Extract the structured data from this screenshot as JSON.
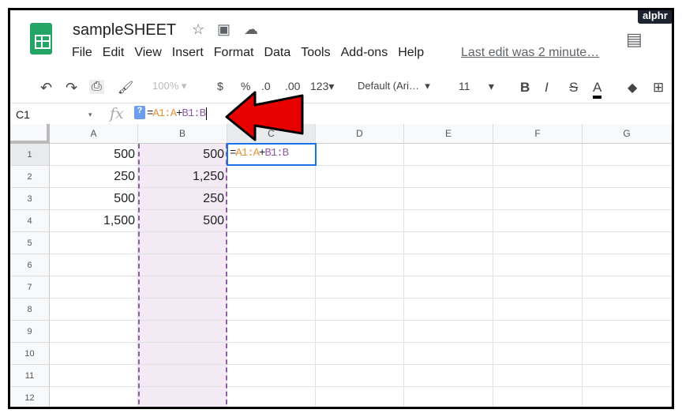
{
  "app": {
    "title": "sampleSHEET",
    "last_edit": "Last edit was 2 minute…",
    "watermark": "alphr"
  },
  "menu": [
    "File",
    "Edit",
    "View",
    "Insert",
    "Format",
    "Data",
    "Tools",
    "Add-ons",
    "Help"
  ],
  "toolbar": {
    "zoom": "100%",
    "currency": "$",
    "percent": "%",
    "dec_less": ".0",
    "dec_more": ".00",
    "format": "123",
    "font": "Default (Ari…",
    "size": "11",
    "bold": "B",
    "italic": "I",
    "strike": "S",
    "textcolor": "A"
  },
  "formula_bar": {
    "name_box": "C1",
    "fx": "fx",
    "help": "?",
    "formula_parts": [
      "=",
      "A1:A",
      "+",
      "B1:B"
    ]
  },
  "columns": [
    "A",
    "B",
    "C",
    "D",
    "E",
    "F",
    "G"
  ],
  "rows": [
    "1",
    "2",
    "3",
    "4",
    "5",
    "6",
    "7",
    "8",
    "9",
    "10",
    "11",
    "12"
  ],
  "cells": {
    "A": [
      "500",
      "250",
      "500",
      "1,500"
    ],
    "B": [
      "500",
      "1,250",
      "250",
      "500"
    ]
  },
  "editing_cell": {
    "ref": "C1",
    "parts": [
      "=",
      "A1:A",
      "+",
      "B1:B"
    ]
  },
  "colors": {
    "accent": "#1a73e8",
    "range_a": "#e8923a",
    "range_b": "#8e5ea2",
    "highlight_b": "#f3eaf6",
    "arrow": "#e60000"
  }
}
